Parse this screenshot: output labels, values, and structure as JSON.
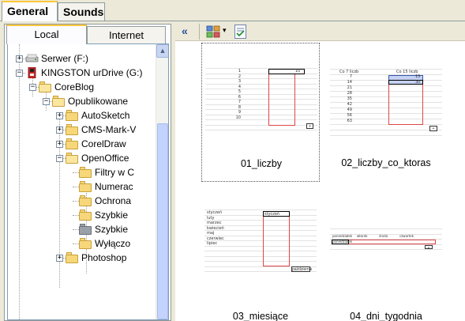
{
  "top_tabs": {
    "general": "General",
    "sounds": "Sounds"
  },
  "left_tabs": {
    "local": "Local",
    "internet": "Internet"
  },
  "tree": [
    {
      "label": "Serwer (F:)",
      "expander": "+",
      "icon": "drive-icon"
    },
    {
      "label": "KINGSTON urDrive (G:)",
      "expander": "−",
      "icon": "usb-drive-icon"
    },
    {
      "label": "CoreBlog",
      "expander": "−",
      "icon": "folder-open-icon"
    },
    {
      "label": "Opublikowane",
      "expander": "−",
      "icon": "folder-open-icon"
    },
    {
      "label": "AutoSketch",
      "expander": "+",
      "icon": "folder-icon"
    },
    {
      "label": "CMS-Mark-V",
      "expander": "+",
      "icon": "folder-icon"
    },
    {
      "label": "CorelDraw",
      "expander": "+",
      "icon": "folder-icon"
    },
    {
      "label": "OpenOffice",
      "expander": "−",
      "icon": "folder-open-icon"
    },
    {
      "label": "Filtry w C",
      "expander": "",
      "icon": "folder-icon"
    },
    {
      "label": "Numerac",
      "expander": "",
      "icon": "folder-icon"
    },
    {
      "label": "Ochrona",
      "expander": "",
      "icon": "folder-icon"
    },
    {
      "label": "Szybkie",
      "expander": "",
      "icon": "folder-icon"
    },
    {
      "label": "Szybkie",
      "expander": "",
      "icon": "folder-grey-icon"
    },
    {
      "label": "Wyłączo",
      "expander": "",
      "icon": "folder-icon"
    },
    {
      "label": "Photoshop",
      "expander": "+",
      "icon": "folder-icon"
    }
  ],
  "toolbar": {
    "collapse": "«",
    "dropdown_arrow": "▾"
  },
  "thumbnails": [
    {
      "caption": "01_liczby",
      "selected": true
    },
    {
      "caption": "02_liczby_co_ktoras",
      "selected": false
    },
    {
      "caption": "03_miesiące",
      "selected": false
    },
    {
      "caption": "04_dni_tygodnia",
      "selected": false
    }
  ],
  "mini": {
    "t1_numbers": [
      "1",
      "2",
      "3",
      "4",
      "5",
      "6",
      "7",
      "8",
      "9",
      "10"
    ],
    "t1_cell": "10",
    "t2_head1": "Co 7 liczb",
    "t2_head2": "Co 15 liczb",
    "t2_numbers": [
      "7",
      "14",
      "21",
      "28",
      "35",
      "42",
      "49",
      "56",
      "63"
    ],
    "t2_cells": [
      "15",
      "30"
    ],
    "t3_months": [
      "styczeń",
      "luty",
      "marzec",
      "kwiecień",
      "maj",
      "czerwiec",
      "lipiec"
    ],
    "t3_cell": "styczeń",
    "t3_badge": "październik",
    "t4_days": [
      "poniedziałek",
      "wtorek",
      "środa",
      "czwartek"
    ],
    "t4_cell": "poniedziałek"
  },
  "colors": {
    "accent_tab": "#ffc83c",
    "folder": "#f7d77a",
    "selection_red": "#e04646"
  }
}
